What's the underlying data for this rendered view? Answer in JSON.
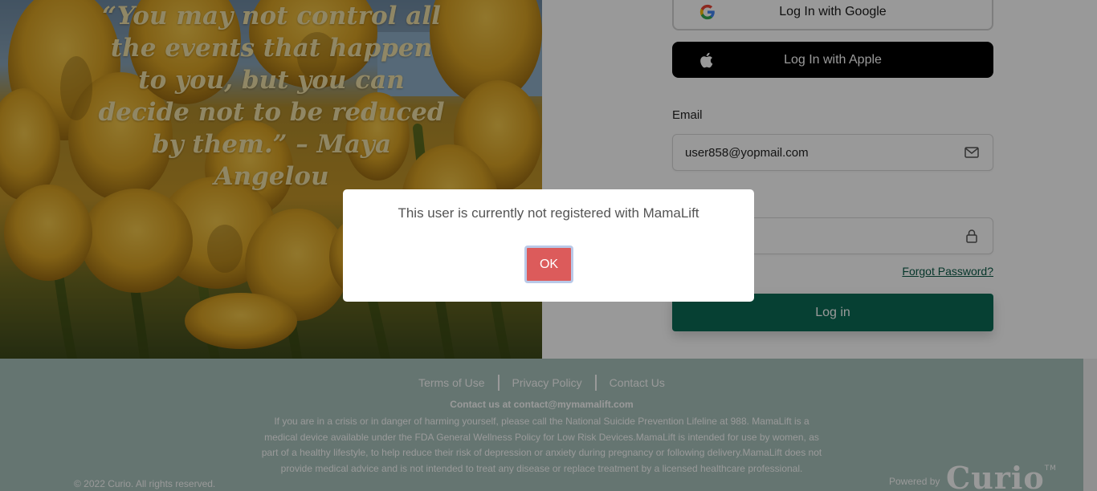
{
  "hero": {
    "quote": "“You may not control all the events that happen to you, but you can decide not to be reduced by them.” – Maya Angelou"
  },
  "login": {
    "google_label": "Log In with Google",
    "apple_label": "Log In with Apple",
    "email_label": "Email",
    "email_value": "user858@yopmail.com",
    "password_value": "",
    "forgot_label": "Forgot Password?",
    "login_label": "Log in"
  },
  "footer": {
    "links": [
      "Terms of Use",
      "Privacy Policy",
      "Contact Us"
    ],
    "contact": "Contact us at contact@mymamalift.com",
    "disclaimer": "If you are in a crisis or in danger of harming yourself, please call the National Suicide Prevention Lifeline at 988. MamaLift is a medical device available under the FDA General Wellness Policy for Low Risk Devices.MamaLift is intended for use by women, as part of a healthy lifestyle, to help reduce their risk of depression or anxiety during pregnancy or following delivery.MamaLift does not provide medical advice and is not intended to treat any disease or replace treatment by a licensed healthcare professional.",
    "copyright": "© 2022 Curio. All rights reserved.",
    "powered_by": "Powered by",
    "brand": "Curio",
    "trademark": "TM"
  },
  "modal": {
    "message": "This user is currently not registered with MamaLift",
    "ok_label": "OK"
  },
  "colors": {
    "primary": "#0a6b55",
    "ok_button": "#dc5b5b",
    "footer_bg": "#a8c4bd",
    "apple_button": "#000000"
  },
  "icons": [
    "google-icon",
    "apple-icon",
    "mail-icon",
    "lock-icon"
  ]
}
